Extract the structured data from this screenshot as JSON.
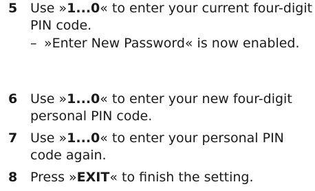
{
  "steps": [
    {
      "number": "5",
      "pre": "Use »",
      "key": "1...0",
      "post": "« to enter your current four-digit PIN code.",
      "sub": {
        "dash": "–",
        "text": "»Enter New Password« is now enabled."
      }
    },
    {
      "number": "6",
      "pre": "Use »",
      "key": "1...0",
      "post": "« to enter your new four-digit personal PIN code."
    },
    {
      "number": "7",
      "pre": "Use »",
      "key": "1...0",
      "post": "« to enter your personal PIN code again."
    },
    {
      "number": "8",
      "pre": "Press »",
      "key": "EXIT",
      "post": "« to finish the setting."
    }
  ]
}
